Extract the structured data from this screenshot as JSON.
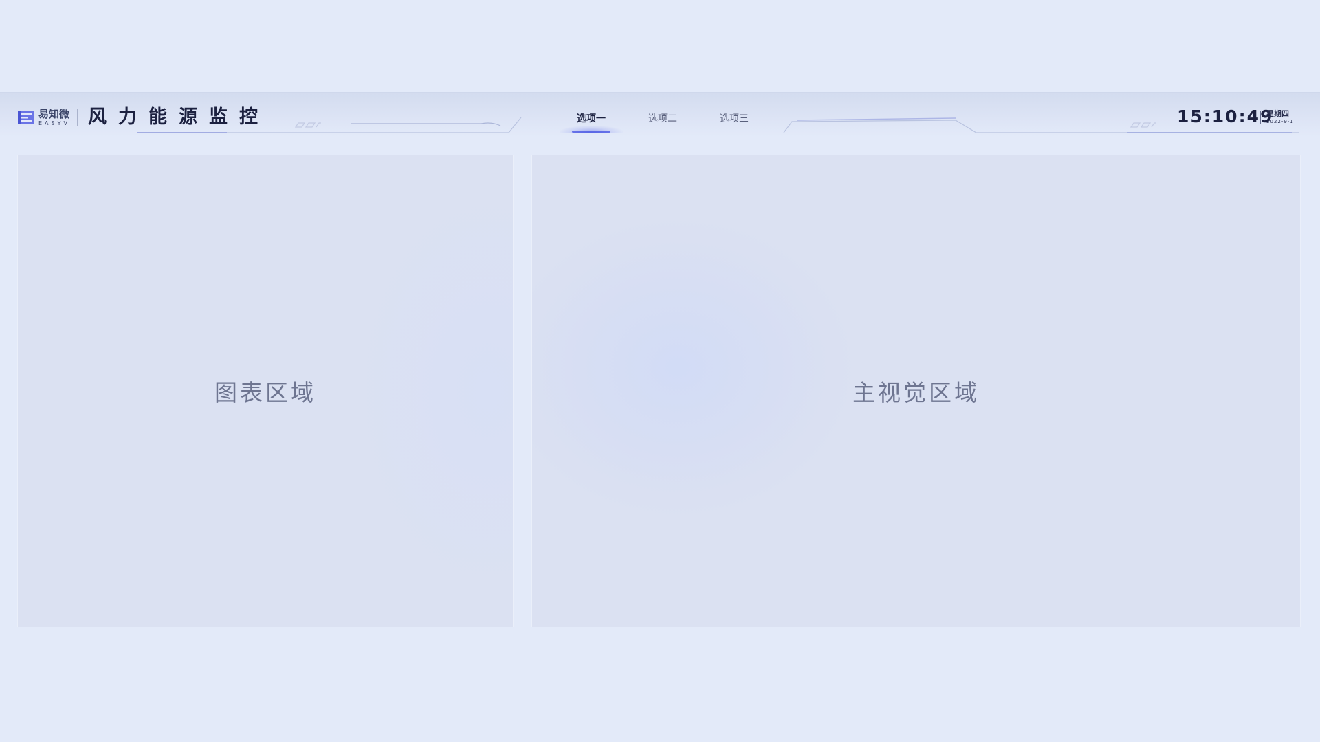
{
  "header": {
    "logo_cn": "易知微",
    "logo_en": "EASYV",
    "title": "风力能源监控",
    "tabs": [
      {
        "label": "选项一",
        "active": true
      },
      {
        "label": "选项二",
        "active": false
      },
      {
        "label": "选项三",
        "active": false
      }
    ],
    "time": "15:10:49",
    "weekday": "星期四",
    "date": "2022-9-1"
  },
  "panels": {
    "chart_area": {
      "label": "图表区域"
    },
    "main_visual_area": {
      "label": "主视觉区域"
    }
  },
  "colors": {
    "background": "#e3eaf9",
    "panel": "#dbe1f2",
    "accent": "#5b67e6",
    "text_dark": "#1c2140",
    "text_muted": "#6e7591"
  },
  "icons": {
    "logo": "easyv-logo-icon"
  }
}
